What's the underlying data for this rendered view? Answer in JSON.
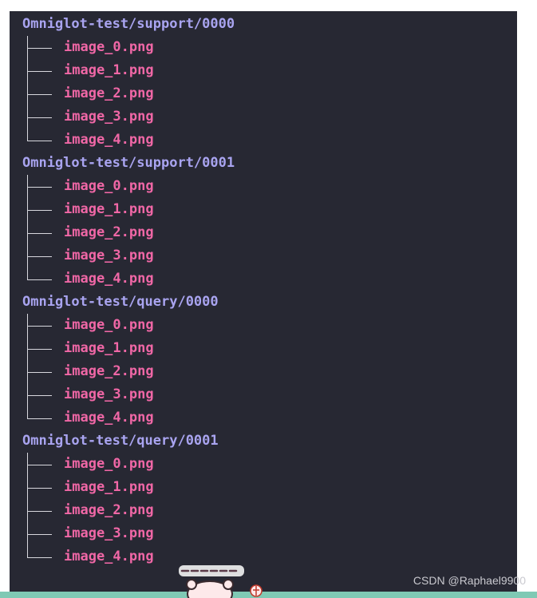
{
  "groups": [
    {
      "path": "Omniglot-test/support/0000",
      "files": [
        "image_0.png",
        "image_1.png",
        "image_2.png",
        "image_3.png",
        "image_4.png"
      ]
    },
    {
      "path": "Omniglot-test/support/0001",
      "files": [
        "image_0.png",
        "image_1.png",
        "image_2.png",
        "image_3.png",
        "image_4.png"
      ]
    },
    {
      "path": "Omniglot-test/query/0000",
      "files": [
        "image_0.png",
        "image_1.png",
        "image_2.png",
        "image_3.png",
        "image_4.png"
      ]
    },
    {
      "path": "Omniglot-test/query/0001",
      "files": [
        "image_0.png",
        "image_1.png",
        "image_2.png",
        "image_3.png",
        "image_4.png"
      ]
    }
  ],
  "watermark": "CSDN @Raphael9900",
  "colors": {
    "background": "#272833",
    "directory": "#a9a4f0",
    "file": "#f067a6",
    "tree_line": "#d8d8de",
    "bottom_bar": "#7fc9b4"
  },
  "decoration": "cartoon-sticker-icon"
}
